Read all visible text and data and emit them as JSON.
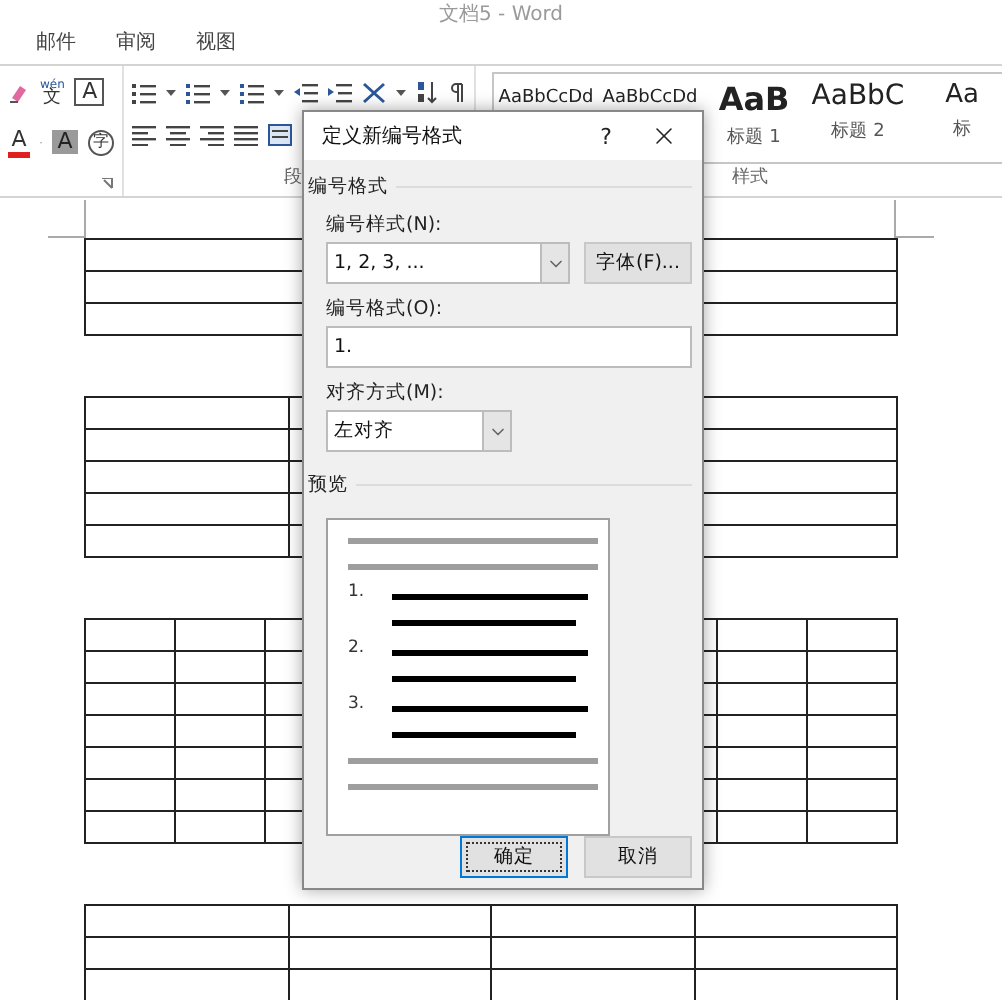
{
  "window": {
    "title": "文档5 - Word"
  },
  "ribbon_tabs": [
    {
      "label": "邮件",
      "selected": false
    },
    {
      "label": "审阅",
      "selected": false
    },
    {
      "label": "视图",
      "selected": false
    }
  ],
  "font_group": {
    "row_1": [
      {
        "kind": "phonetic",
        "ruby": "wén",
        "label": "文"
      },
      {
        "kind": "boxed",
        "label": "A"
      }
    ],
    "row_2": [
      {
        "kind": "font-color",
        "label": "A"
      },
      {
        "kind": "shaded",
        "label": "A"
      },
      {
        "kind": "enclosed",
        "label": "字"
      }
    ]
  },
  "paragraph_group": {
    "label": "段"
  },
  "styles_group": {
    "label": "样式",
    "styles": [
      {
        "kind": "normal",
        "sample": "AaBbCcDd"
      },
      {
        "kind": "normal",
        "sample": "AaBbCcDd"
      },
      {
        "kind": "heading1",
        "sample": "AaB",
        "name": "标题 1"
      },
      {
        "kind": "heading2",
        "sample": "AaBbC",
        "name": "标题 2"
      },
      {
        "kind": "heading3",
        "sample": "Aa",
        "name": "标"
      }
    ]
  },
  "dialog": {
    "title": "定义新编号格式",
    "help": "?",
    "section_format": "编号格式",
    "number_style": {
      "label": "编号样式(N):",
      "value": "1, 2, 3, ..."
    },
    "font_button": "字体(F)...",
    "number_format": {
      "label": "编号格式(O):",
      "value": "1."
    },
    "alignment": {
      "label": "对齐方式(M):",
      "value": "左对齐"
    },
    "section_preview": "预览",
    "preview_numbers": [
      "1.",
      "2.",
      "3."
    ],
    "buttons": [
      {
        "label": "确定",
        "focused": true
      },
      {
        "label": "取消",
        "focused": false
      }
    ]
  }
}
